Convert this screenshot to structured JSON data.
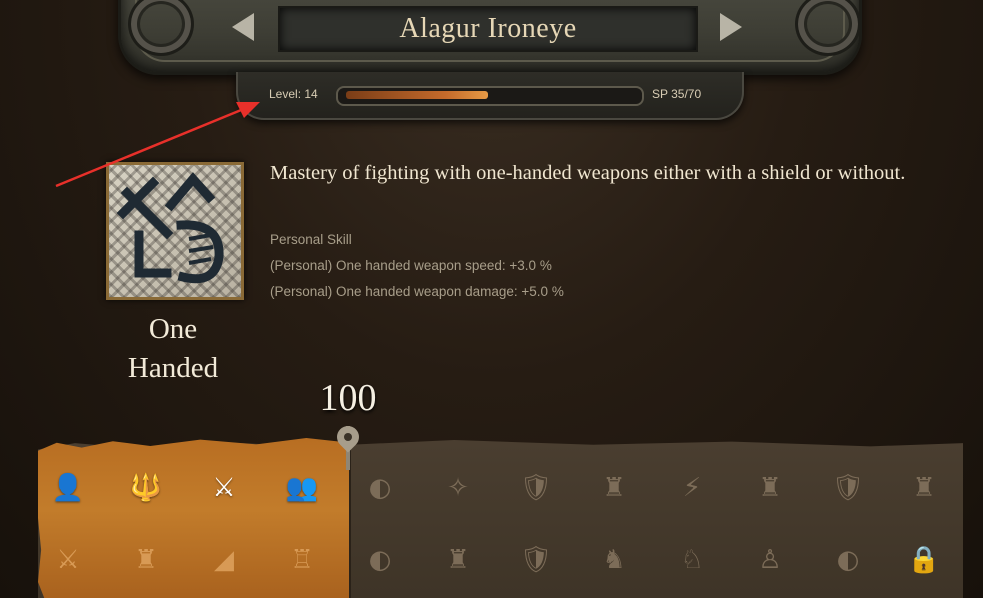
{
  "character": {
    "name": "Alagur Ironeye"
  },
  "progress": {
    "level_text": "Level: 14",
    "sp_text": "SP 35/70",
    "xp_fraction": 0.5
  },
  "skill": {
    "name_line1": "One",
    "name_line2": "Handed",
    "description": "Mastery of fighting with one-handed weapons either with a shield or without.",
    "type": "Personal Skill",
    "effects": [
      "(Personal) One handed weapon speed: +3.0 %",
      "(Personal) One handed weapon damage: +5.0 %"
    ],
    "value": "100"
  },
  "colors": {
    "accent": "#c27c2b",
    "annotation": "#e8302a",
    "bar": "#c46a2b"
  },
  "perks": {
    "row1": [
      "person-icon",
      "trident-icon",
      "fighter-icon",
      "group-icon",
      "shield-swipe-icon",
      "sparkle-icon",
      "shield-fist-icon",
      "castle-person-icon",
      "slash-icon",
      "castle-person-icon",
      "shield-fist-icon",
      "castle-person-icon"
    ],
    "row2": [
      "crossed-swords-icon",
      "castle-icon",
      "ramp-icon",
      "castle-group-icon",
      "shield-swipe-icon",
      "castle-person-icon",
      "shield-fist-icon",
      "soldier-icon",
      "horse-rider-icon",
      "archers-icon",
      "shield-swipe-icon",
      "lock-icon"
    ]
  }
}
